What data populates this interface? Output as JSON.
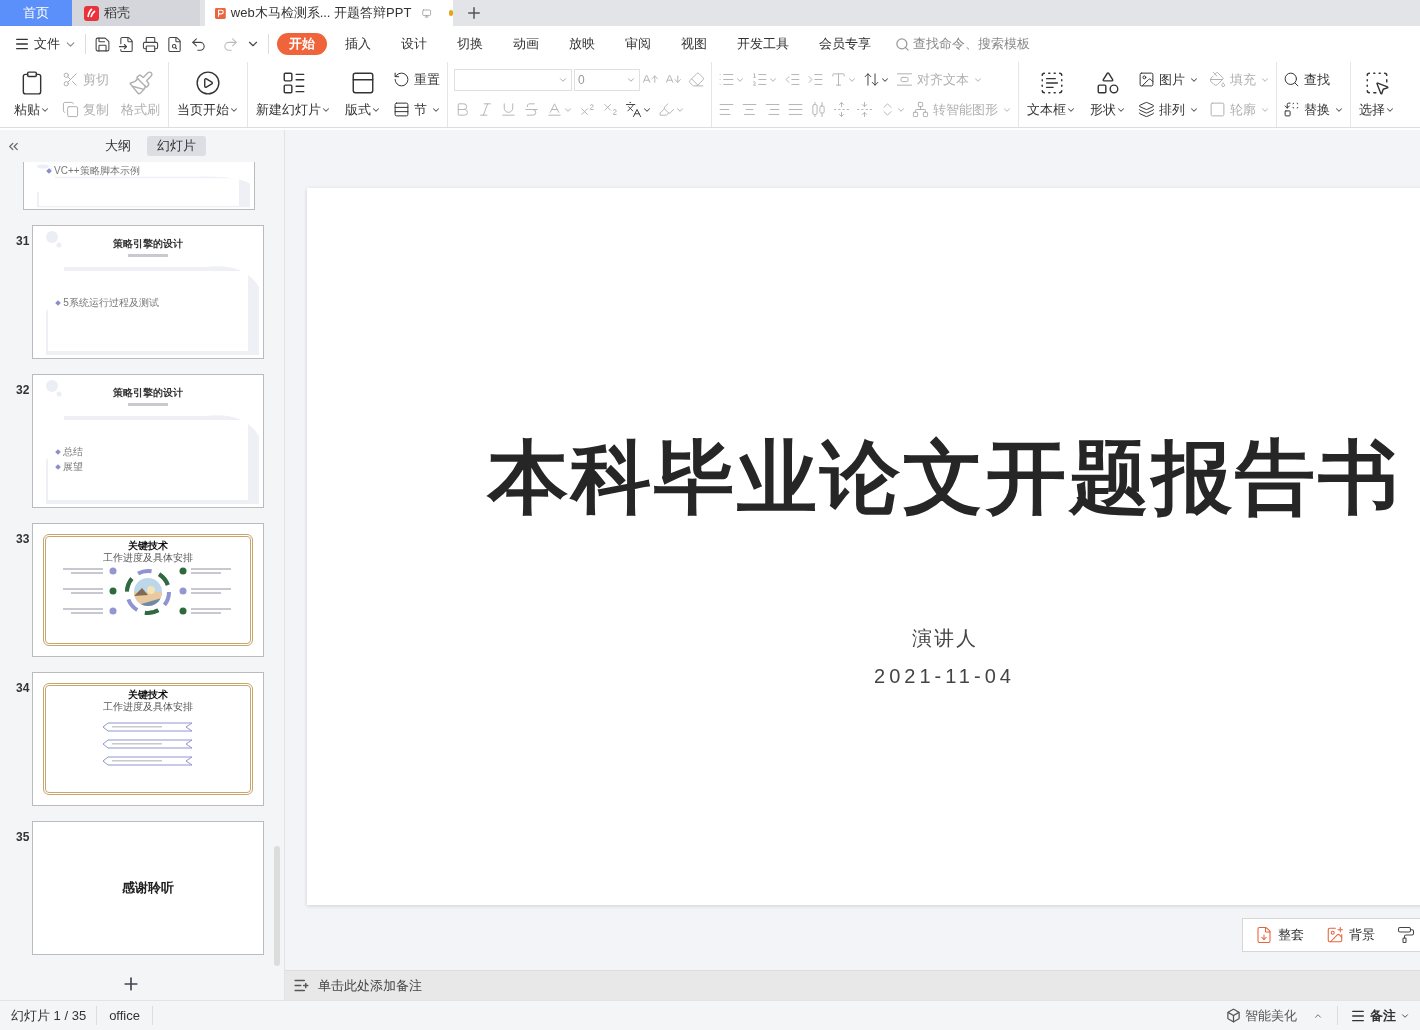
{
  "tabs": [
    {
      "label": "首页",
      "kind": "home",
      "selected": false
    },
    {
      "label": "稻壳",
      "kind": "docer",
      "selected": false
    },
    {
      "label": "web木马检测系... 开题答辩PPT",
      "kind": "document",
      "selected": true,
      "unsaved": true
    }
  ],
  "file_menu": "文件",
  "ribbon_tabs": [
    {
      "label": "开始",
      "selected": true
    },
    {
      "label": "插入",
      "selected": false
    },
    {
      "label": "设计",
      "selected": false
    },
    {
      "label": "切换",
      "selected": false
    },
    {
      "label": "动画",
      "selected": false
    },
    {
      "label": "放映",
      "selected": false
    },
    {
      "label": "审阅",
      "selected": false
    },
    {
      "label": "视图",
      "selected": false
    },
    {
      "label": "开发工具",
      "selected": false
    },
    {
      "label": "会员专享",
      "selected": false
    }
  ],
  "command_search": {
    "placeholder": "查找命令、搜索模板"
  },
  "ribbon_groups": [
    {
      "columns": [
        {
          "kind": "large",
          "label": "粘贴",
          "dropdown": true,
          "disabled": false
        },
        {
          "kind": "stack",
          "rows": [
            [
              {
                "kind": "button",
                "label": "剪切",
                "disabled": true
              }
            ],
            [
              {
                "kind": "button",
                "label": "复制",
                "disabled": true
              }
            ]
          ]
        },
        {
          "kind": "large",
          "label": "格式刷",
          "dropdown": false,
          "disabled": true
        }
      ]
    },
    {
      "columns": [
        {
          "kind": "large",
          "label": "当页开始",
          "dropdown": true,
          "disabled": false
        }
      ]
    },
    {
      "columns": [
        {
          "kind": "large",
          "label": "新建幻灯片",
          "dropdown": true,
          "disabled": false
        },
        {
          "kind": "large",
          "label": "版式",
          "dropdown": true,
          "disabled": false
        },
        {
          "kind": "stack",
          "rows": [
            [
              {
                "kind": "button",
                "label": "重置",
                "disabled": false
              }
            ],
            [
              {
                "kind": "button",
                "label": "节",
                "dropdown": true,
                "disabled": false
              }
            ]
          ]
        }
      ]
    },
    {
      "columns": [
        {
          "kind": "stack",
          "rows": [
            [
              {
                "kind": "field"
              },
              {
                "kind": "field",
                "value": "0"
              },
              {
                "kind": "icon",
                "disabled": true
              },
              {
                "kind": "icon",
                "disabled": true
              },
              {
                "kind": "icon",
                "disabled": true
              }
            ],
            [
              {
                "kind": "icon",
                "disabled": true
              },
              {
                "kind": "icon",
                "disabled": true
              },
              {
                "kind": "icon",
                "disabled": true
              },
              {
                "kind": "icon",
                "disabled": true
              },
              {
                "kind": "icon",
                "disabled": true,
                "dropdown": true
              },
              {
                "kind": "icon",
                "disabled": true
              },
              {
                "kind": "icon",
                "disabled": true
              },
              {
                "kind": "icon",
                "disabled": false,
                "dropdown": true
              },
              {
                "kind": "icon",
                "disabled": true,
                "dropdown": true
              }
            ]
          ]
        }
      ]
    },
    {
      "columns": [
        {
          "kind": "stack",
          "rows": [
            [
              {
                "kind": "icon",
                "disabled": true,
                "dropdown": true
              },
              {
                "kind": "icon",
                "disabled": true,
                "dropdown": true
              },
              {
                "kind": "icon",
                "disabled": true
              },
              {
                "kind": "icon",
                "disabled": true
              },
              {
                "kind": "icon",
                "disabled": true,
                "dropdown": true
              },
              {
                "kind": "icon",
                "disabled": false,
                "dropdown": true
              },
              {
                "kind": "button",
                "label": "对齐文本",
                "dropdown": true,
                "disabled": true
              }
            ],
            [
              {
                "kind": "icon",
                "disabled": true
              },
              {
                "kind": "icon",
                "disabled": true
              },
              {
                "kind": "icon",
                "disabled": true
              },
              {
                "kind": "icon",
                "disabled": true
              },
              {
                "kind": "icon",
                "disabled": true
              },
              {
                "kind": "icon",
                "disabled": true
              },
              {
                "kind": "icon",
                "disabled": true
              },
              {
                "kind": "icon",
                "disabled": true,
                "dropdown": true
              },
              {
                "kind": "button",
                "label": "转智能图形",
                "dropdown": true,
                "disabled": true
              }
            ]
          ]
        }
      ]
    },
    {
      "columns": [
        {
          "kind": "large",
          "label": "文本框",
          "dropdown": true,
          "disabled": false
        },
        {
          "kind": "large",
          "label": "形状",
          "dropdown": true,
          "disabled": false
        },
        {
          "kind": "stack",
          "rows": [
            [
              {
                "kind": "button",
                "label": "图片",
                "dropdown": true,
                "disabled": false
              }
            ],
            [
              {
                "kind": "button",
                "label": "排列",
                "dropdown": true,
                "disabled": false
              }
            ]
          ]
        },
        {
          "kind": "stack",
          "rows": [
            [
              {
                "kind": "button",
                "label": "填充",
                "dropdown": true,
                "disabled": true
              }
            ],
            [
              {
                "kind": "button",
                "label": "轮廓",
                "dropdown": true,
                "disabled": true
              }
            ]
          ]
        }
      ]
    },
    {
      "columns": [
        {
          "kind": "stack",
          "rows": [
            [
              {
                "kind": "button",
                "label": "查找",
                "disabled": false
              }
            ],
            [
              {
                "kind": "button",
                "label": "替换",
                "dropdown": true,
                "disabled": false
              }
            ]
          ]
        }
      ]
    },
    {
      "columns": [
        {
          "kind": "large",
          "label": "选择",
          "dropdown": true,
          "disabled": false
        }
      ]
    }
  ],
  "sidebar": {
    "view_tabs": [
      {
        "label": "大纲",
        "selected": false
      },
      {
        "label": "幻灯片",
        "selected": true
      }
    ],
    "slides": [
      {
        "kind": "content",
        "cut": true,
        "selected": false,
        "bullets": [
          "VC++策略脚本示例"
        ]
      },
      {
        "number": "31",
        "kind": "content",
        "selected": false,
        "title": "策略引擎的设计",
        "bullets": [
          "5系统运行过程及测试"
        ]
      },
      {
        "number": "32",
        "kind": "content",
        "selected": false,
        "title": "策略引擎的设计",
        "bullets": [
          "总结",
          "展望"
        ]
      },
      {
        "number": "33",
        "kind": "cycle",
        "selected": false,
        "title": "关键技术",
        "subtitle": "工作进度及具体安排"
      },
      {
        "number": "34",
        "kind": "arrows",
        "selected": false,
        "title": "关键技术",
        "subtitle": "工作进度及具体安排"
      },
      {
        "number": "35",
        "kind": "ending",
        "selected": false,
        "title": "感谢聆听"
      }
    ]
  },
  "slide": {
    "title": "本科毕业论文开题报告书",
    "presenter": "演讲人",
    "date": "2021-11-04"
  },
  "float_toolbar": [
    {
      "label": "整套"
    },
    {
      "label": "背景"
    },
    {
      "kind": "icon-only"
    }
  ],
  "notes": {
    "placeholder": "单击此处添加备注"
  },
  "status_bar": {
    "slide_counter": "幻灯片 1 / 35",
    "theme": "office",
    "beautify": "智能美化",
    "notes": "备注"
  }
}
